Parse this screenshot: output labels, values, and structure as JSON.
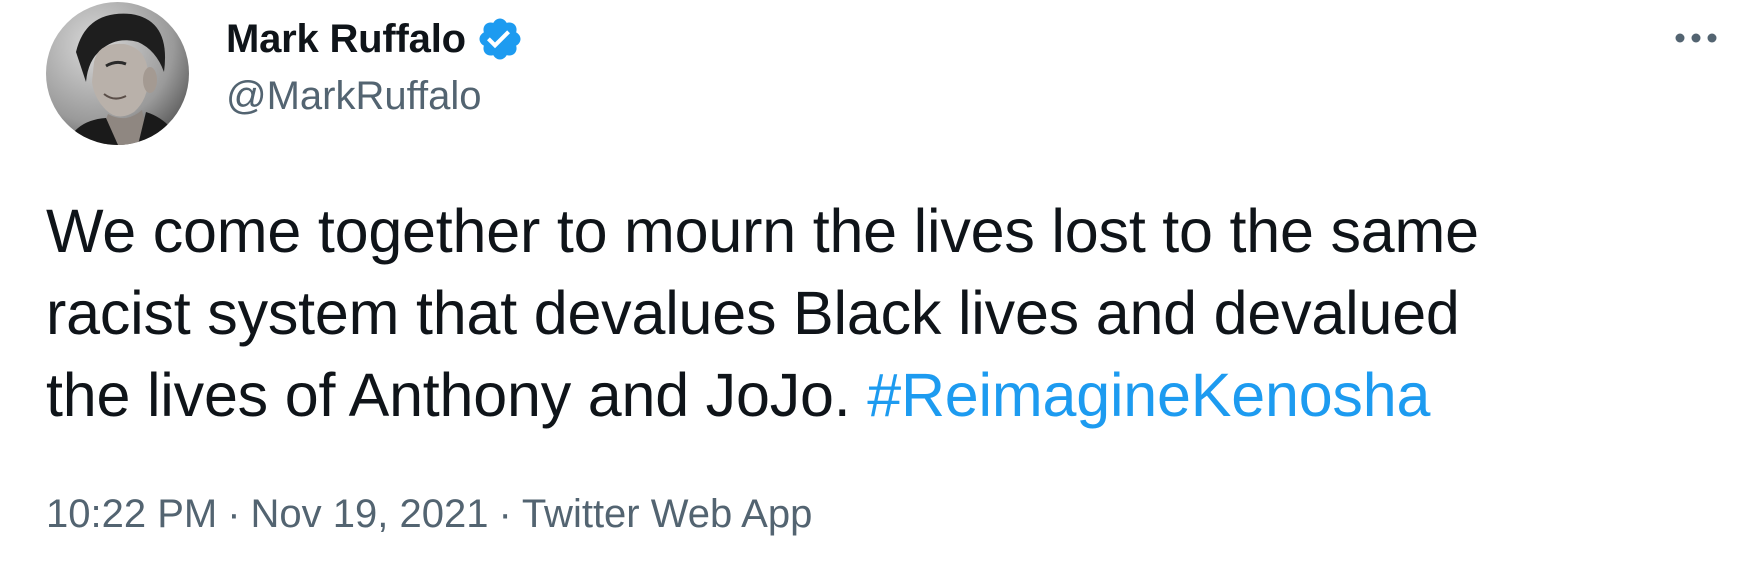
{
  "author": {
    "display_name": "Mark Ruffalo",
    "handle": "@MarkRuffalo",
    "verified": true,
    "avatar_icon": "profile-photo"
  },
  "tweet": {
    "text_lines": [
      "We come together to mourn the lives lost to the same",
      "racist system that devalues Black lives and devalued",
      "the lives of Anthony and JoJo. "
    ],
    "hashtag": "#ReimagineKenosha"
  },
  "meta": {
    "time": "10:22 PM",
    "date": "Nov 19, 2021",
    "source": "Twitter Web App",
    "separator": "·"
  },
  "icons": {
    "more": "more-horizontal-icon",
    "verified": "verified-badge-icon"
  },
  "colors": {
    "text": "#0f1419",
    "secondary": "#536471",
    "accent": "#1d9bf0"
  }
}
